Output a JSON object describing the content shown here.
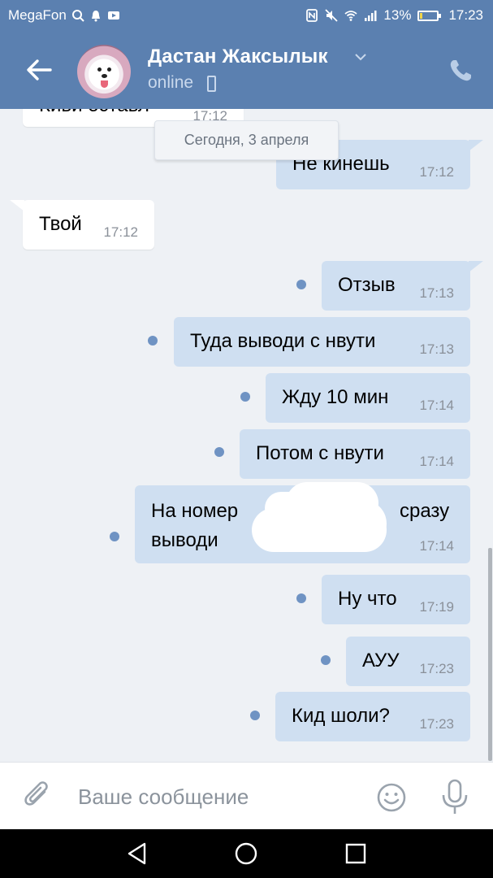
{
  "status_bar": {
    "carrier": "MegaFon",
    "battery": "13%",
    "battery_level": 0.13,
    "time": "17:23"
  },
  "header": {
    "contact_name": "Дастан Жаксылык",
    "status": "online"
  },
  "chat": {
    "top_partial": {
      "text": "Киви оставл",
      "time": "17:12"
    },
    "date_separator": "Сегодня, 3 апреля",
    "messages": [
      {
        "dir": "out",
        "text": "Не кинешь",
        "time": "17:12",
        "unread": false
      },
      {
        "dir": "in",
        "text": "Твой",
        "time": "17:12",
        "unread": false
      },
      {
        "dir": "out",
        "text": "Отзыв",
        "time": "17:13",
        "unread": true
      },
      {
        "dir": "out",
        "text": "Туда выводи с нвути",
        "time": "17:13",
        "unread": true
      },
      {
        "dir": "out",
        "text": "Жду 10 мин",
        "time": "17:14",
        "unread": true
      },
      {
        "dir": "out",
        "text": "Потом с нвути",
        "time": "17:14",
        "unread": true
      },
      {
        "dir": "out",
        "text_line1": "На номер",
        "text_line1_end": "сразу",
        "text_line2": "выводи",
        "time": "17:14",
        "unread": true
      },
      {
        "dir": "out",
        "text": "Ну что",
        "time": "17:19",
        "unread": true
      },
      {
        "dir": "out",
        "text": "АУУ",
        "time": "17:23",
        "unread": true
      },
      {
        "dir": "out",
        "text": "Кид шоли?",
        "time": "17:23",
        "unread": true
      }
    ]
  },
  "input": {
    "placeholder": "Ваше сообщение",
    "value": ""
  },
  "colors": {
    "header_bg": "#5b80b0",
    "outgoing_bubble": "#cfdff1",
    "incoming_bubble": "#ffffff",
    "unread_dot": "#6f93c3",
    "chat_bg": "#eef1f5"
  },
  "icons": {
    "back": "arrow-left-icon",
    "call": "phone-icon",
    "attach": "paperclip-icon",
    "emoji": "smiley-icon",
    "mic": "microphone-icon",
    "nav_back": "triangle-back-icon",
    "nav_home": "circle-home-icon",
    "nav_recent": "square-recent-icon"
  }
}
